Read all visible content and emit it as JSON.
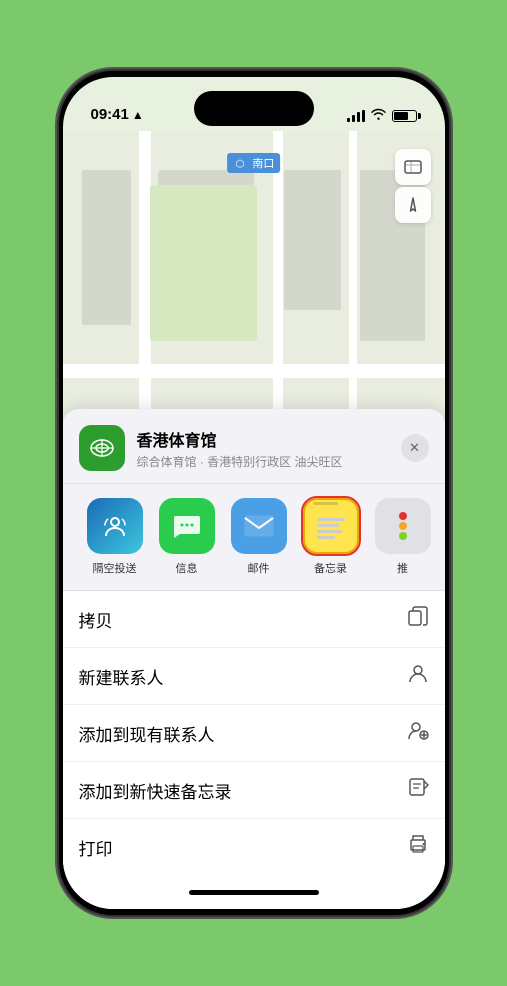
{
  "status_bar": {
    "time": "09:41",
    "location_icon": "▲"
  },
  "map": {
    "label": "南口",
    "station_prefix": "⬡",
    "controls": {
      "map_type": "🗺",
      "location": "➤"
    },
    "venue_marker": "🏟",
    "venue_marker_name": "香港体育馆"
  },
  "bottom_sheet": {
    "venue_icon": "🏟",
    "venue_name": "香港体育馆",
    "venue_desc": "综合体育馆 · 香港特别行政区 油尖旺区",
    "close_label": "✕",
    "share_items": [
      {
        "id": "airdrop",
        "label": "隔空投送"
      },
      {
        "id": "messages",
        "label": "信息"
      },
      {
        "id": "mail",
        "label": "邮件"
      },
      {
        "id": "notes",
        "label": "备忘录"
      },
      {
        "id": "more",
        "label": "推"
      }
    ],
    "action_items": [
      {
        "label": "拷贝",
        "icon": "⎘"
      },
      {
        "label": "新建联系人",
        "icon": "👤"
      },
      {
        "label": "添加到现有联系人",
        "icon": "👤+"
      },
      {
        "label": "添加到新快速备忘录",
        "icon": "📋"
      },
      {
        "label": "打印",
        "icon": "🖨"
      }
    ]
  }
}
